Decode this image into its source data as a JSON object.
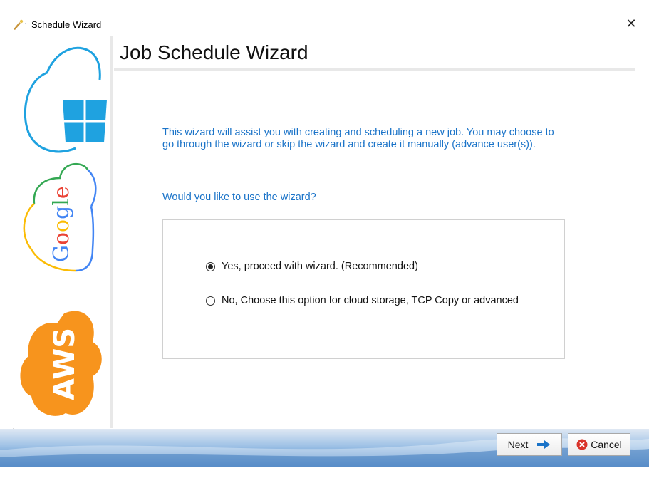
{
  "window": {
    "title": "Schedule Wizard",
    "close_glyph": "✕"
  },
  "page": {
    "title": "Job Schedule Wizard"
  },
  "content": {
    "intro": "This wizard will assist you with creating and scheduling a new job. You may choose to go through the wizard or skip the wizard and create it manually (advance user(s)).",
    "question": "Would you like to use the wizard?",
    "options": [
      {
        "label": "Yes, proceed with wizard. (Recommended)",
        "checked": true
      },
      {
        "label": "No, Choose this option for cloud storage, TCP Copy or advanced",
        "checked": false
      }
    ]
  },
  "sidebar": {
    "logos": [
      {
        "name": "azure-cloud-logo",
        "color": "#1fa2e0"
      },
      {
        "name": "google-cloud-logo",
        "text": "Google"
      },
      {
        "name": "aws-cloud-logo",
        "text": "AWS",
        "color": "#f7941d"
      }
    ]
  },
  "buttons": {
    "next": {
      "label": "Next",
      "icon": "arrow-right-icon",
      "color": "#1a73c8"
    },
    "cancel": {
      "label": "Cancel",
      "icon": "cancel-icon",
      "color": "#d9342b"
    }
  }
}
